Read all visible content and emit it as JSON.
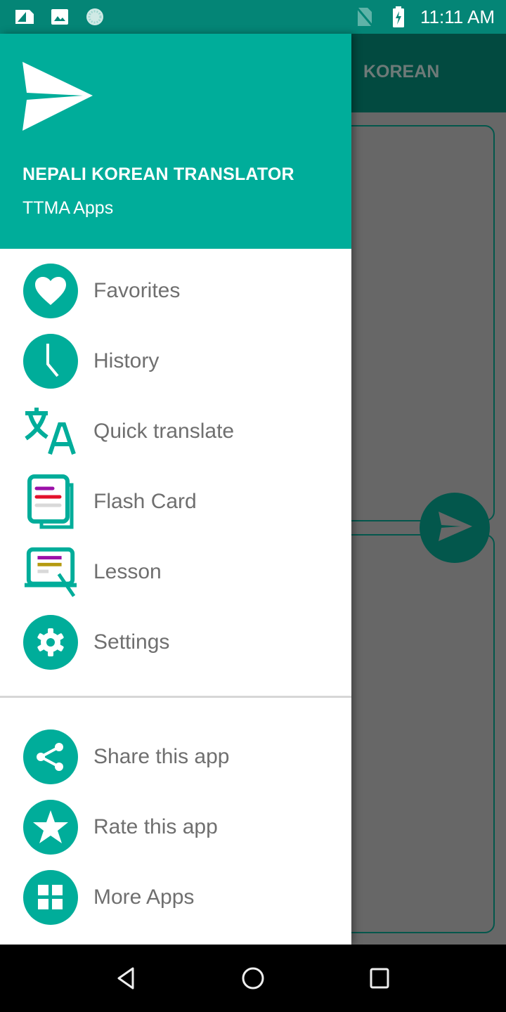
{
  "status_bar": {
    "time": "11:11 AM",
    "left_icons": [
      "sim-card-icon",
      "image-icon",
      "loading-icon"
    ],
    "right_icons": [
      "no-sim-icon",
      "battery-charging-icon"
    ]
  },
  "background_app": {
    "target_language_tab": "KOREAN",
    "translate_button_icon": "send-icon",
    "toolbar_color": "#024a40",
    "accent_color": "#03574c"
  },
  "drawer": {
    "header": {
      "logo_icon": "paper-plane-icon",
      "title": "NEPALI KOREAN TRANSLATOR",
      "subtitle": "TTMA Apps",
      "color": "#00ad9a"
    },
    "primary_items": [
      {
        "label": "Favorites",
        "icon": "heart-icon"
      },
      {
        "label": "History",
        "icon": "clock-icon"
      },
      {
        "label": "Quick translate",
        "icon": "translate-icon"
      },
      {
        "label": "Flash Card",
        "icon": "flash-card-icon"
      },
      {
        "label": "Lesson",
        "icon": "lesson-icon"
      },
      {
        "label": "Settings",
        "icon": "gear-icon"
      }
    ],
    "secondary_items": [
      {
        "label": "Share this app",
        "icon": "share-icon"
      },
      {
        "label": "Rate this app",
        "icon": "star-icon"
      },
      {
        "label": "More Apps",
        "icon": "grid-icon"
      }
    ]
  },
  "nav_bar": {
    "buttons": [
      "back",
      "home",
      "recents"
    ]
  }
}
